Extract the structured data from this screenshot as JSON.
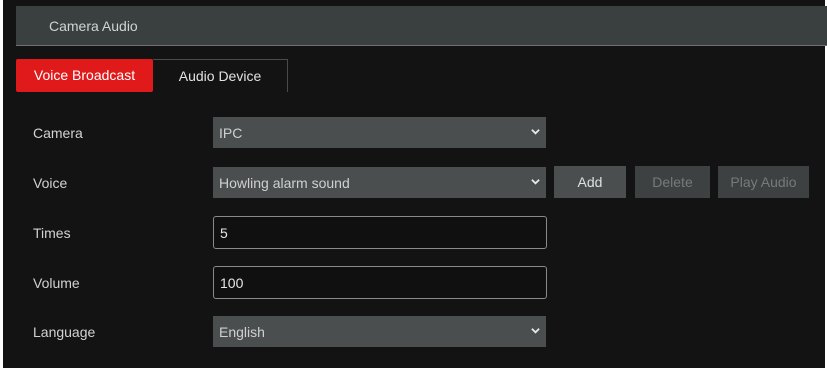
{
  "header": {
    "title": "Camera Audio"
  },
  "tabs": [
    {
      "label": "Voice Broadcast",
      "active": true
    },
    {
      "label": "Audio Device",
      "active": false
    }
  ],
  "form": {
    "camera": {
      "label": "Camera",
      "value": "IPC"
    },
    "voice": {
      "label": "Voice",
      "value": "Howling alarm sound"
    },
    "times": {
      "label": "Times",
      "value": "5"
    },
    "volume": {
      "label": "Volume",
      "value": "100"
    },
    "language": {
      "label": "Language",
      "value": "English"
    }
  },
  "buttons": {
    "add": "Add",
    "delete": "Delete",
    "play_audio": "Play Audio"
  },
  "colors": {
    "accent": "#e01a1a",
    "background": "#131313",
    "control": "#4b4e4e"
  },
  "icons": {
    "dropdown": "chevron-down-icon"
  }
}
